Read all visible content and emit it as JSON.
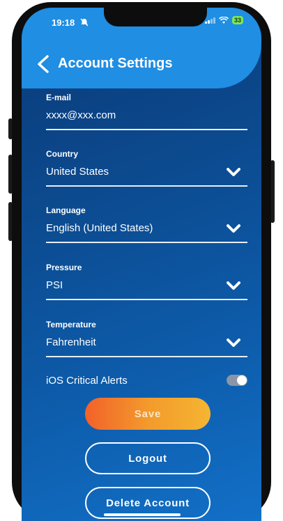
{
  "status": {
    "time": "19:18",
    "battery": "33"
  },
  "header": {
    "title": "Account Settings"
  },
  "fields": [
    {
      "label": "E-mail",
      "value": "xxxx@xxx.com",
      "dropdown": false
    },
    {
      "label": "Country",
      "value": "United States",
      "dropdown": true
    },
    {
      "label": "Language",
      "value": "English (United States)",
      "dropdown": true
    },
    {
      "label": "Pressure",
      "value": "PSI",
      "dropdown": true
    },
    {
      "label": "Temperature",
      "value": "Fahrenheit",
      "dropdown": true
    }
  ],
  "critical_alerts": {
    "label": "iOS Critical Alerts",
    "enabled": true
  },
  "buttons": {
    "save": "Save",
    "logout": "Logout",
    "delete": "Delete Account"
  },
  "colors": {
    "header": "#1f8ee3",
    "background": "#0c4a8f",
    "save_gradient_start": "#f2612a",
    "save_gradient_end": "#f5b532"
  }
}
